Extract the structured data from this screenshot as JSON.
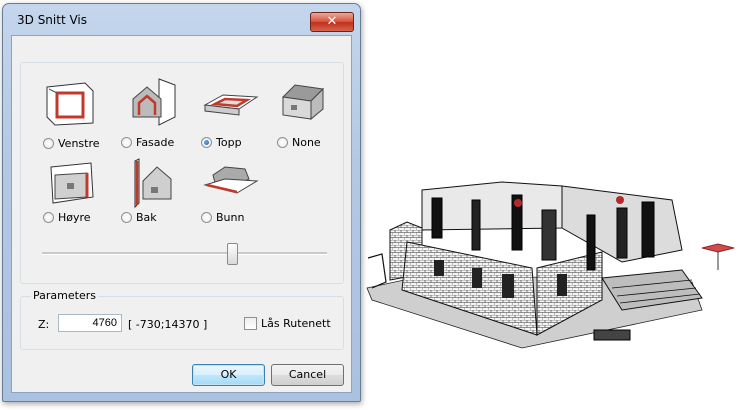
{
  "window": {
    "title": "3D Snitt Vis",
    "close_glyph": "✕"
  },
  "views": [
    {
      "label": "Venstre",
      "selected": false,
      "icon": "view-left-icon"
    },
    {
      "label": "Fasade",
      "selected": false,
      "icon": "view-facade-icon"
    },
    {
      "label": "Topp",
      "selected": true,
      "icon": "view-top-icon"
    },
    {
      "label": "None",
      "selected": false,
      "icon": "view-none-icon"
    },
    {
      "label": "Høyre",
      "selected": false,
      "icon": "view-right-icon"
    },
    {
      "label": "Bak",
      "selected": false,
      "icon": "view-back-icon"
    },
    {
      "label": "Bunn",
      "selected": false,
      "icon": "view-bottom-icon"
    }
  ],
  "slider": {
    "level": 0.65
  },
  "parameters": {
    "label": "Parameters",
    "z_label": "Z:",
    "z_value": "4760",
    "range_text": "[ -730;14370 ]",
    "grid_lock_label": "Lås Rutenett",
    "grid_lock_checked": false
  },
  "buttons": {
    "ok": "OK",
    "cancel": "Cancel"
  },
  "colors": {
    "accent_red": "#c0392b",
    "selection_blue": "#1d5c9c"
  }
}
